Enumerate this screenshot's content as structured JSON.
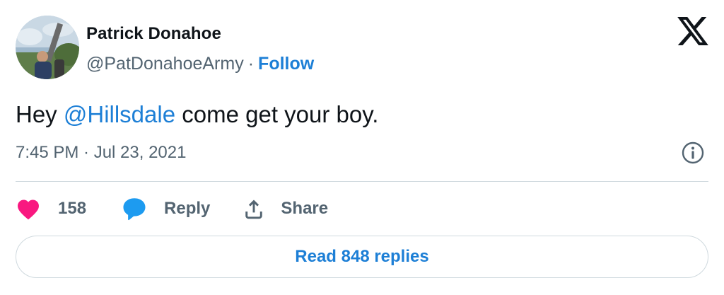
{
  "author": {
    "display_name": "Patrick Donahoe",
    "handle": "@PatDonahoeArmy",
    "separator": "·",
    "follow_label": "Follow"
  },
  "tweet": {
    "text_before": "Hey ",
    "mention": "@Hillsdale",
    "text_after": " come get your boy.",
    "timestamp": "7:45 PM · Jul 23, 2021"
  },
  "actions": {
    "like_count": "158",
    "reply_label": "Reply",
    "share_label": "Share"
  },
  "read_replies_label": "Read 848 replies",
  "icons": {
    "brand": "x-logo-icon",
    "info": "info-icon",
    "like": "heart-icon",
    "reply": "speech-bubble-icon",
    "share": "share-upload-icon"
  },
  "colors": {
    "link": "#1d7fd6",
    "heart": "#f91880",
    "reply_bubble": "#1d9bf0",
    "secondary_text": "#536471",
    "divider": "#cfd9de"
  }
}
